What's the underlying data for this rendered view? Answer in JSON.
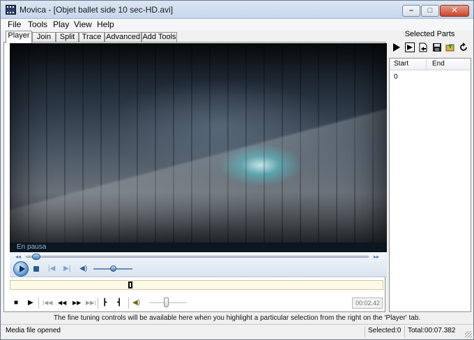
{
  "window": {
    "title": "Movica - [Objet ballet side 10 sec-HD.avi]",
    "minimize_label": "–",
    "maximize_label": "□",
    "close_label": "✕"
  },
  "menu": [
    "File",
    "Tools",
    "Play",
    "View",
    "Help"
  ],
  "tabs": [
    {
      "label": "Player",
      "active": true
    },
    {
      "label": "Join",
      "active": false
    },
    {
      "label": "Split",
      "active": false
    },
    {
      "label": "Trace",
      "active": false
    },
    {
      "label": "Advanced",
      "active": false
    },
    {
      "label": "Add Tools",
      "active": false
    }
  ],
  "player": {
    "status": "En pausa",
    "seek_start_icon": "rewind-mini-icon",
    "seek_end_icon": "fast-forward-mini-icon",
    "seek_position": 0.03,
    "volume_level": 0.5,
    "icons": {
      "play": "play-icon",
      "stop": "stop-icon",
      "prev": "previous-track-icon",
      "next": "next-track-icon",
      "mute": "speaker-icon"
    },
    "glyphs": {
      "seek_start": "◂◂",
      "seek_end": "▸▸",
      "prev": "|◀",
      "next": "▶|",
      "mute": "◀)"
    }
  },
  "selection_strip": {
    "marker_icon": "selection-marker-icon"
  },
  "bottom_toolbar": {
    "stop": "■",
    "play": "▶",
    "first": "|◀◀",
    "rewind": "◀◀",
    "forward": "▶▶",
    "last": "▶▶|",
    "mark_in": "┣",
    "mark_out": "┫",
    "volume": "◀)",
    "time": "00:02.42",
    "volume_level": 0.45
  },
  "selected_parts": {
    "title": "Selected Parts",
    "columns": [
      "Start",
      "End"
    ],
    "rows": [
      {
        "start": "0",
        "end": ""
      }
    ],
    "toolbar_icons": [
      "play-icon",
      "play-selection-icon",
      "export-icon",
      "save-icon",
      "open-folder-icon",
      "refresh-icon"
    ]
  },
  "hint": "The fine tuning controls will be available here when you highlight a particular selection from the right on the 'Player' tab.",
  "status_bar": {
    "message": "Media file opened",
    "selected": "Selected:0",
    "total": "Total:00:07.382"
  },
  "colors": {
    "accent": "#2a5b94",
    "titlebar": "#c5d6ec",
    "close_button": "#c8452c"
  }
}
